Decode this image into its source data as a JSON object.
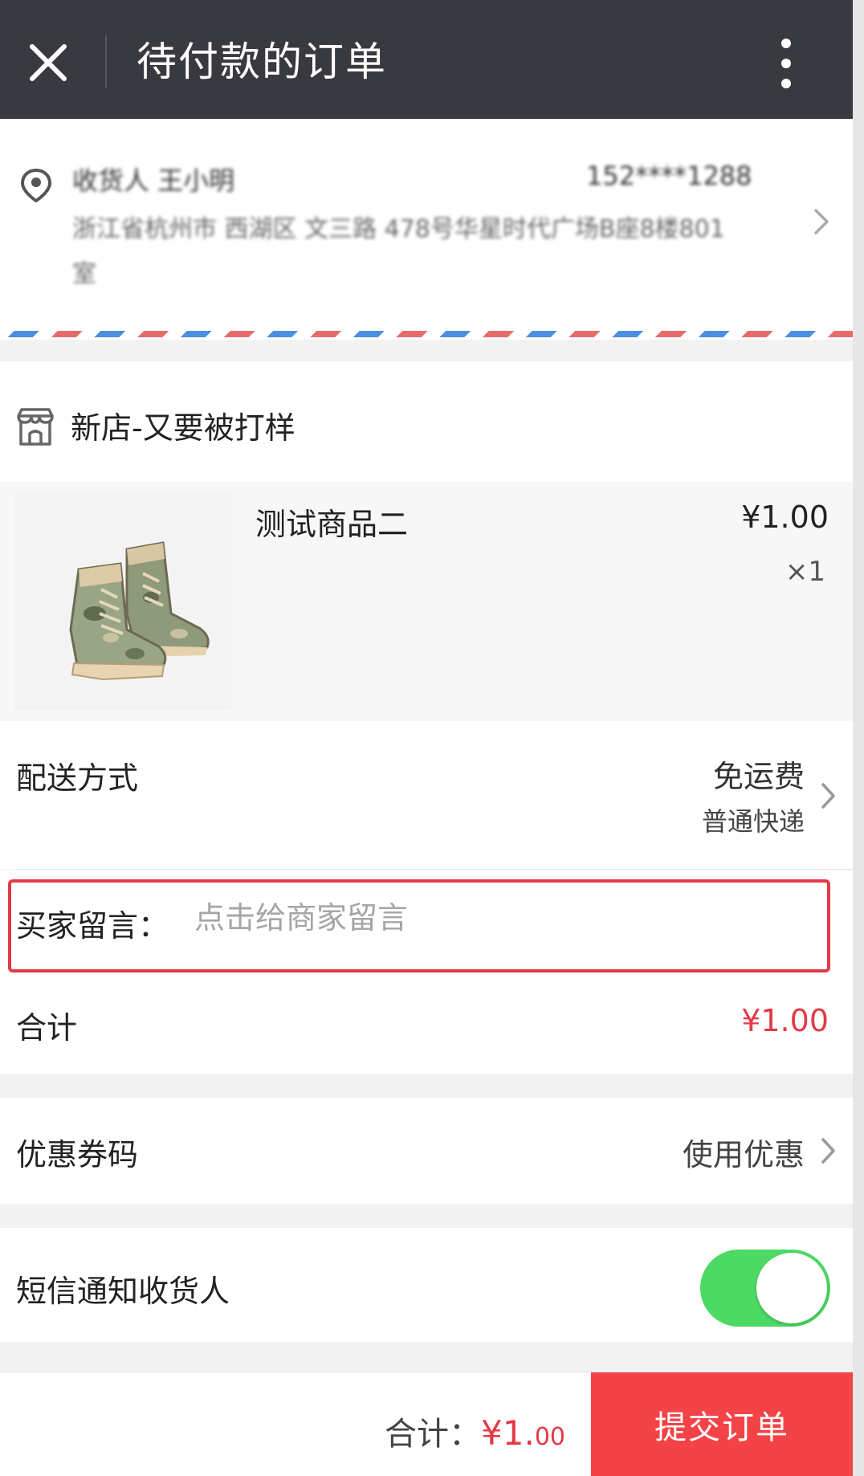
{
  "header": {
    "title": "待付款的订单"
  },
  "address": {
    "name": "收货人 王小明",
    "phone": "152****1288",
    "detail": "浙江省杭州市 西湖区 文三路 478号华星时代广场B座8楼801",
    "detail_tail": "室"
  },
  "shop": {
    "name": "新店-又要被打样"
  },
  "product": {
    "name": "测试商品二",
    "price": "¥1.00",
    "quantity": "×1"
  },
  "delivery": {
    "label": "配送方式",
    "fee": "免运费",
    "method": "普通快递"
  },
  "message": {
    "label": "买家留言：",
    "placeholder": "点击给商家留言"
  },
  "subtotal": {
    "label": "合计",
    "value": "¥1.00"
  },
  "coupon": {
    "label": "优惠券码",
    "value": "使用优惠"
  },
  "sms": {
    "label": "短信通知收货人",
    "enabled": true
  },
  "footer": {
    "total_label": "合计：",
    "total_main": "¥1.",
    "total_cents": "00",
    "submit_label": "提交订单"
  },
  "colors": {
    "header_bg": "#393a3f",
    "accent_red": "#e53946",
    "submit_bg": "#f44346",
    "toggle_on": "#4cd964"
  }
}
